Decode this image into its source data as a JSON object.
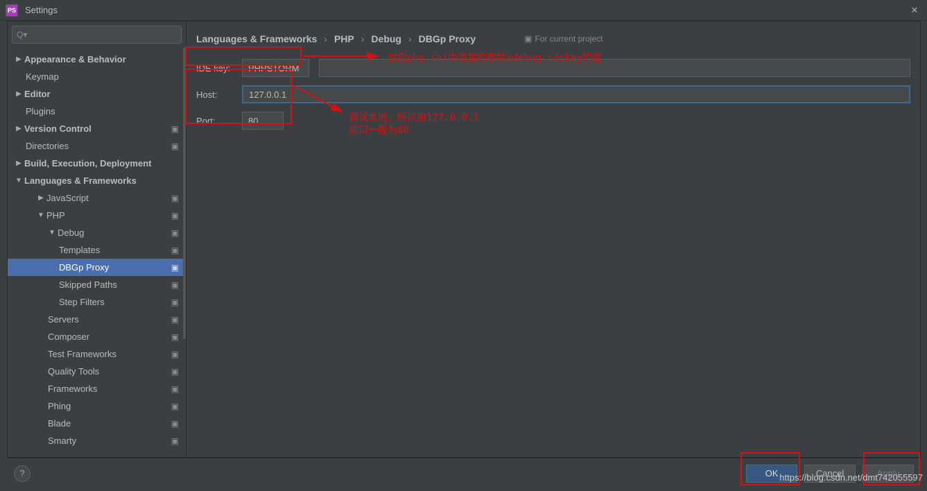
{
  "window": {
    "title": "Settings",
    "app_icon_text": "PS"
  },
  "search": {
    "placeholder": "Q▾"
  },
  "tree": {
    "appearance": "Appearance & Behavior",
    "keymap": "Keymap",
    "editor": "Editor",
    "plugins": "Plugins",
    "vcs": "Version Control",
    "directories": "Directories",
    "build": "Build, Execution, Deployment",
    "langfw": "Languages & Frameworks",
    "javascript": "JavaScript",
    "php": "PHP",
    "debug": "Debug",
    "templates": "Templates",
    "dbgp": "DBGp Proxy",
    "skipped": "Skipped Paths",
    "stepfilters": "Step Filters",
    "servers": "Servers",
    "composer": "Composer",
    "testfw": "Test Frameworks",
    "quality": "Quality Tools",
    "frameworks": "Frameworks",
    "phing": "Phing",
    "blade": "Blade",
    "smarty": "Smarty"
  },
  "badge": "▣",
  "breadcrumb": {
    "a": "Languages & Frameworks",
    "b": "PHP",
    "c": "Debug",
    "d": "DBGp Proxy",
    "scope": "For current project",
    "scope_icon": "▣"
  },
  "form": {
    "ide_label": "IDE key:",
    "ide_value": "PHPSTORM",
    "host_label": "Host:",
    "host_value": "127.0.0.1",
    "port_label": "Port:",
    "port_value": "80"
  },
  "annotations": {
    "ide_note": "对应php.ini中添加的参数xdebug.idekey的值",
    "host_note1": "调试本地，所以用127.0.0.1",
    "host_note2": "端口一般为80"
  },
  "buttons": {
    "ok": "OK",
    "cancel": "Cancel",
    "apply": "Apply",
    "help": "?"
  },
  "watermark": "https://blog.csdn.net/dmt742055597"
}
